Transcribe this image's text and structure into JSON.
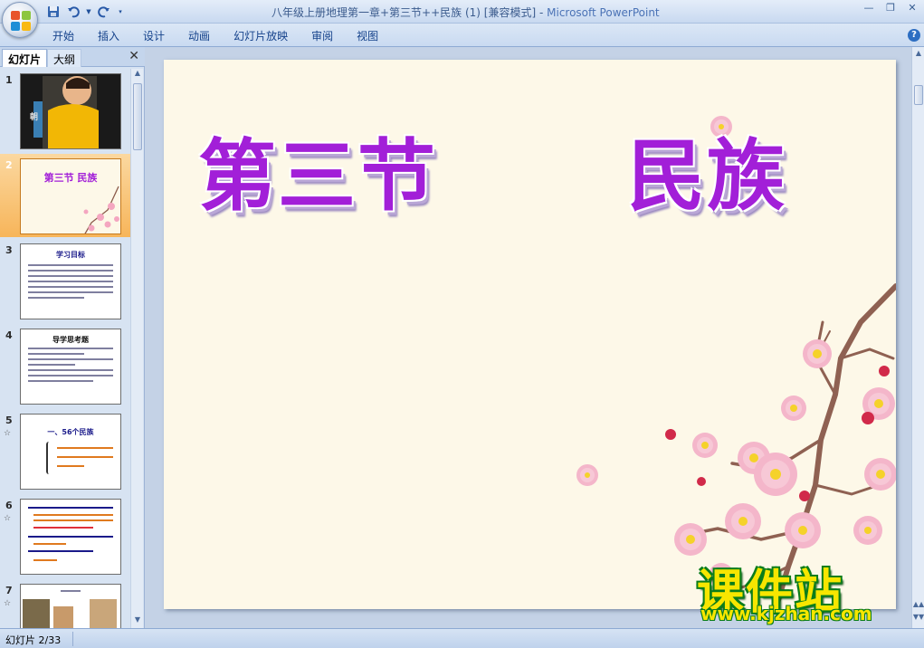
{
  "window": {
    "title": "八年级上册地理第一章+第三节++民族 (1) [兼容模式]",
    "separator": " - ",
    "app_name": "Microsoft PowerPoint"
  },
  "ribbon": {
    "tabs": [
      "开始",
      "插入",
      "设计",
      "动画",
      "幻灯片放映",
      "审阅",
      "视图"
    ]
  },
  "panel": {
    "tab_slides": "幻灯片",
    "tab_outline": "大纲"
  },
  "thumbnails": [
    {
      "num": "1",
      "text": "朝"
    },
    {
      "num": "2",
      "text": "第三节  民族"
    },
    {
      "num": "3",
      "text": "学习目标"
    },
    {
      "num": "4",
      "text": "导学思考题"
    },
    {
      "num": "5",
      "text": "一、56个民族"
    },
    {
      "num": "6",
      "text": ""
    },
    {
      "num": "7",
      "text": ""
    }
  ],
  "slide": {
    "title_left": "第三节",
    "title_right": "民族"
  },
  "watermark": {
    "brand": "课件站",
    "url": "www.kjzhan.com"
  },
  "status": {
    "slide_info": "幻灯片 2/33"
  },
  "colors": {
    "title_purple": "#a21fd8",
    "selection_orange": "#f7b55a",
    "watermark_yellow": "#f7e600"
  }
}
